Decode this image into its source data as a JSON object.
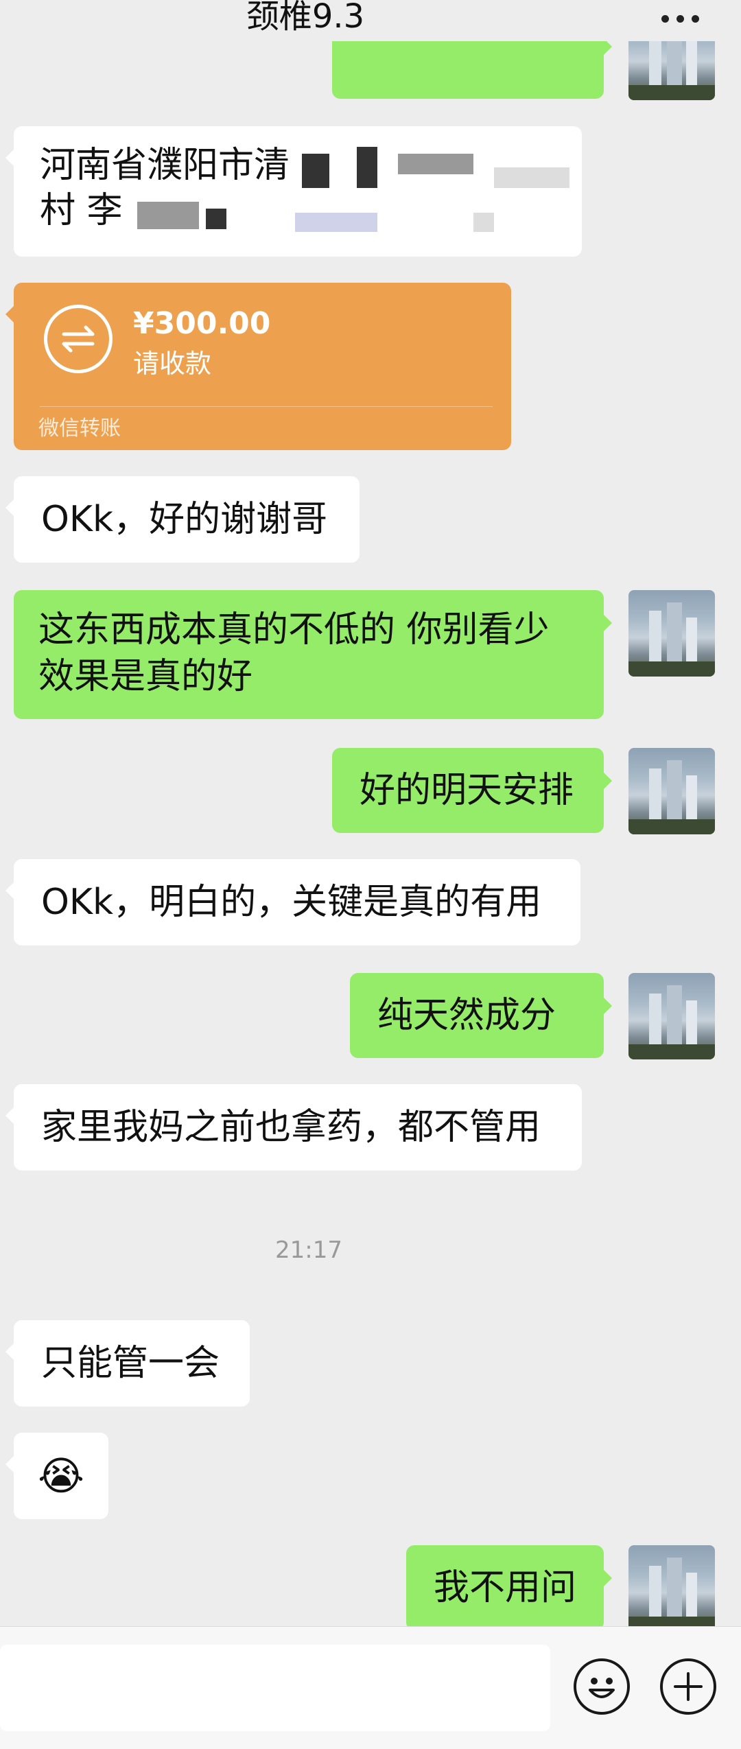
{
  "header": {
    "title": "颈椎9.3"
  },
  "messages": {
    "address_line1": "河南省濮阳市清",
    "address_line2": "村 李",
    "transfer": {
      "amount": "¥300.00",
      "status": "请收款",
      "footer": "微信转账"
    },
    "m1": "OKk，好的谢谢哥",
    "m2_line1": "这东西成本真的不低的 你别看少",
    "m2_line2": "效果是真的好",
    "m3": "好的明天安排",
    "m4": "OKk，明白的，关键是真的有用",
    "m5": "纯天然成分",
    "m6": "家里我妈之前也拿药，都不管用",
    "time": "21:17",
    "m7": "只能管一会",
    "m8_emoji": "😭",
    "m9": "我不用问"
  },
  "icons": {
    "more": "more-icon",
    "emoji": "emoji-icon",
    "plus": "plus-icon",
    "transfer": "transfer-icon"
  },
  "colors": {
    "bg": "#EDEDED",
    "out_bubble": "#95EC69",
    "transfer": "#EDA14E"
  }
}
